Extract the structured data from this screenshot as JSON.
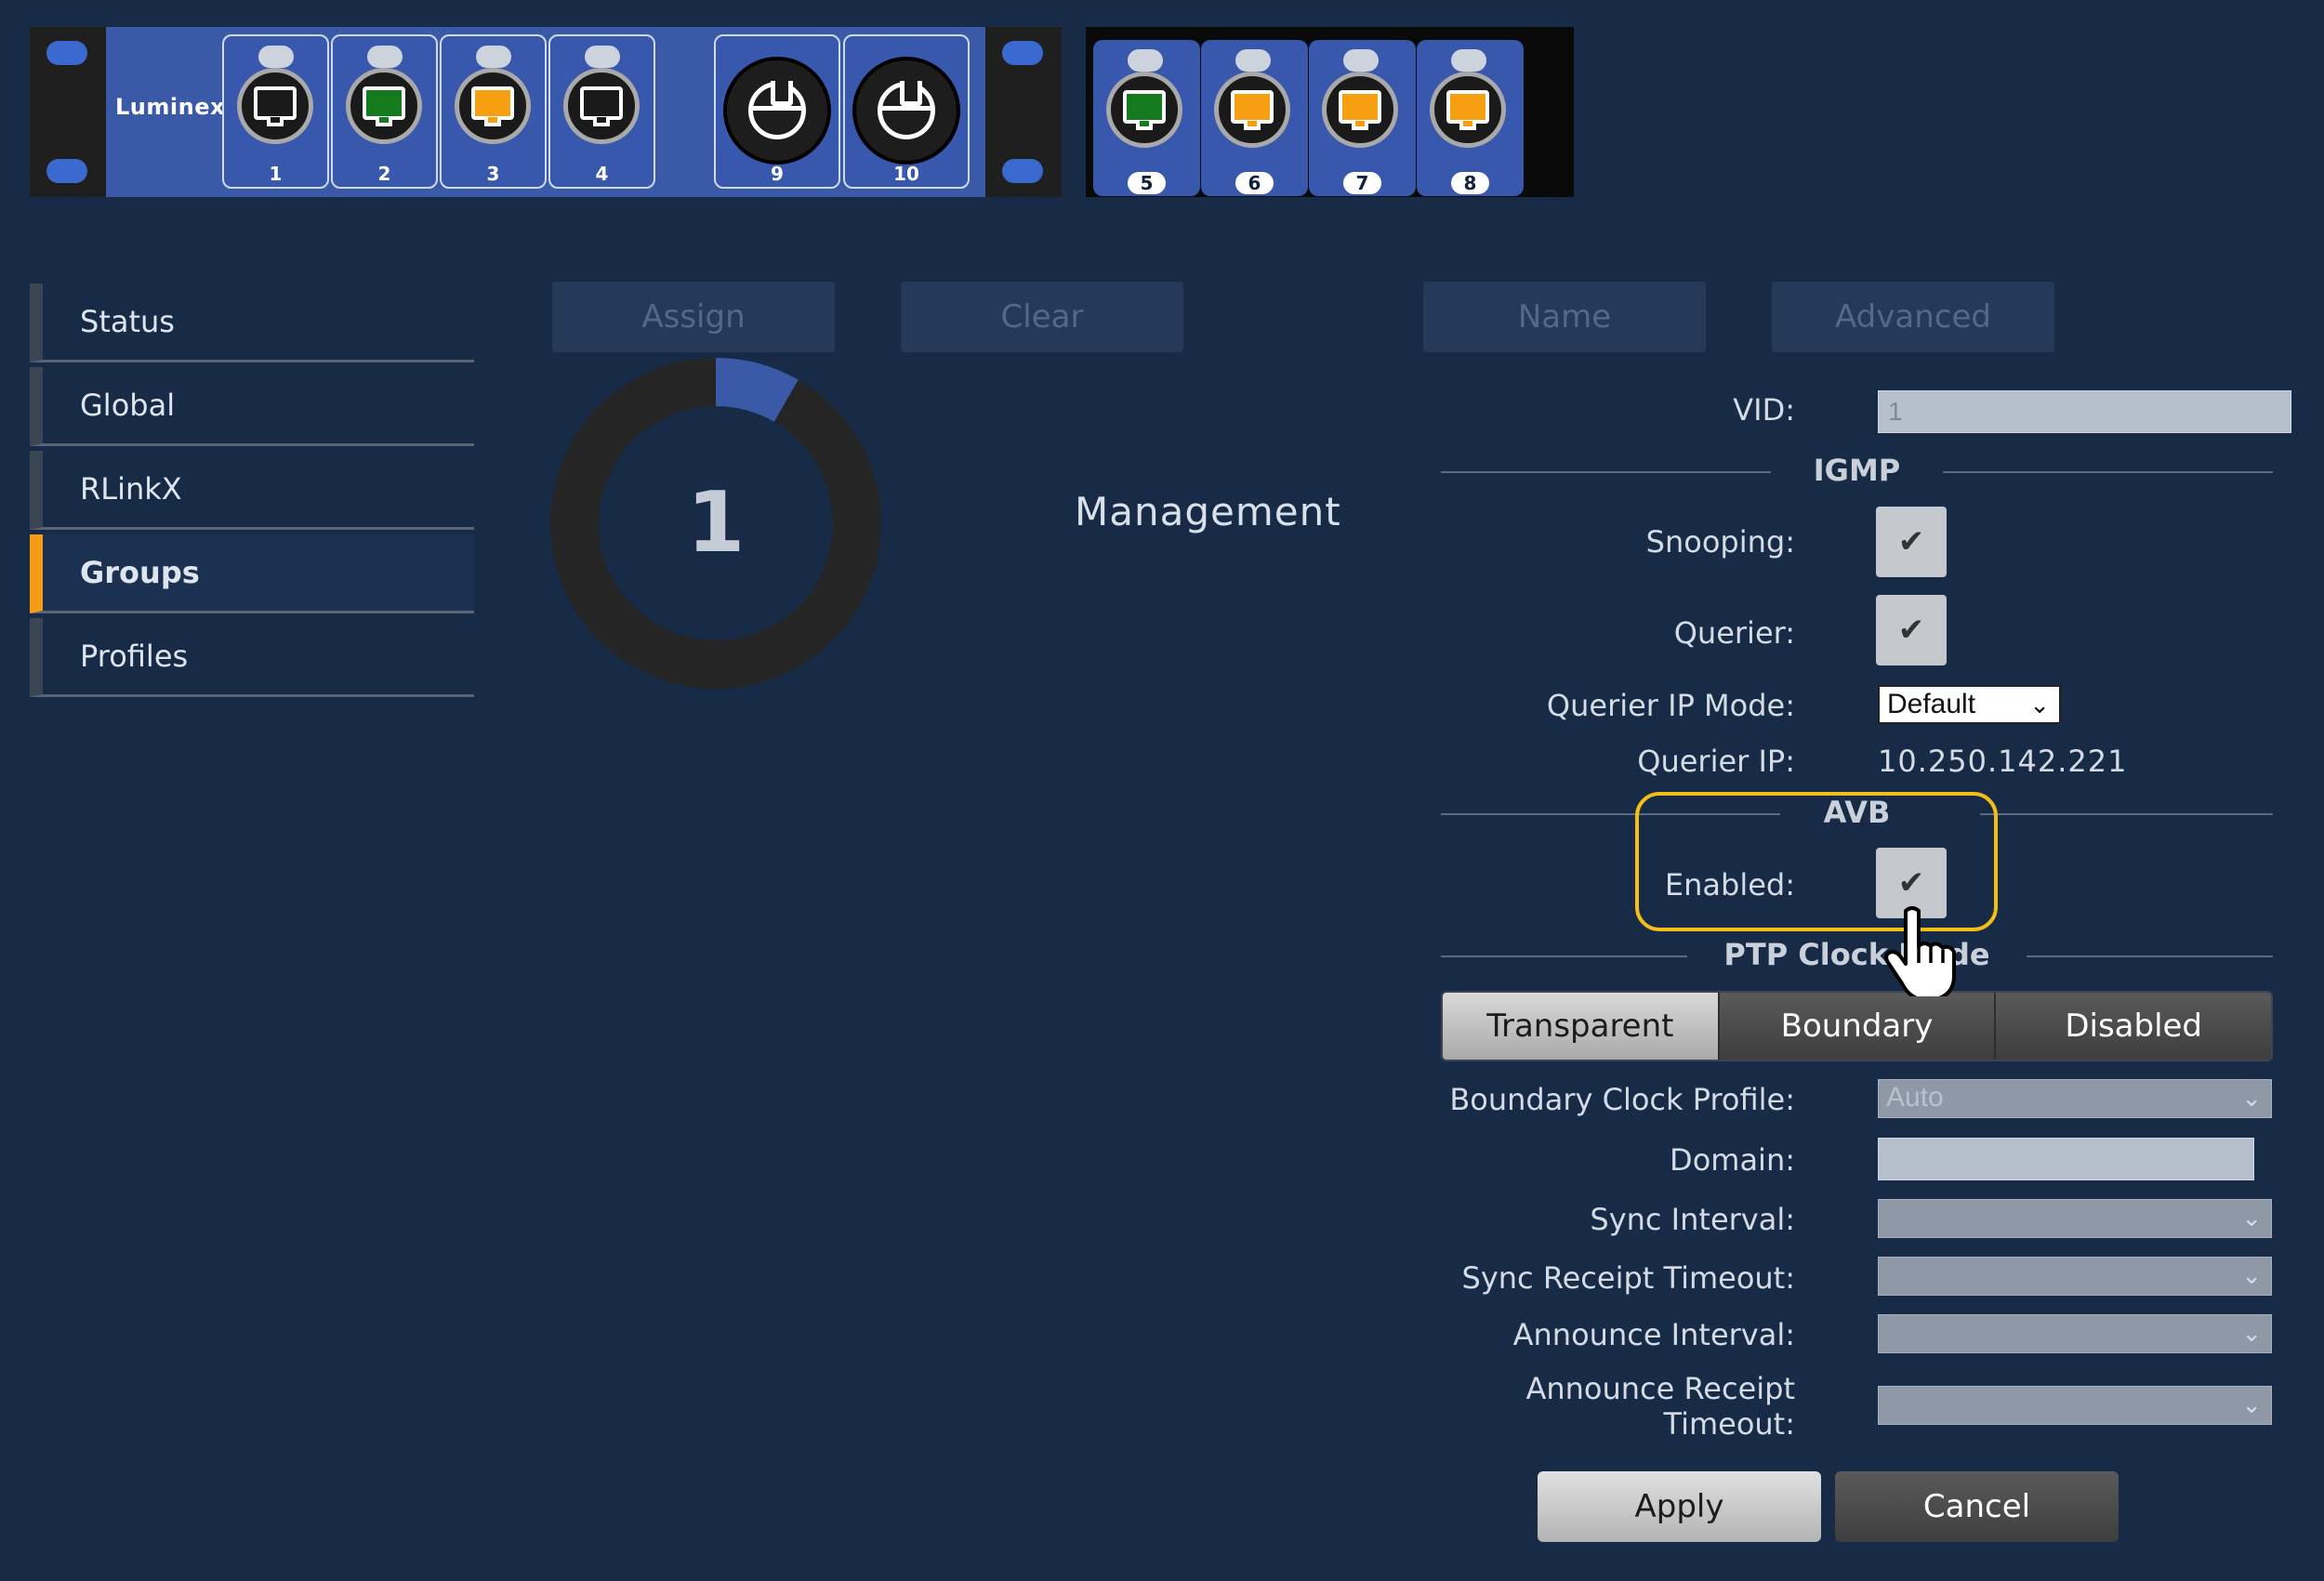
{
  "device": {
    "brand": "Luminex",
    "front_ports": [
      {
        "num": "1",
        "color": "#1a1a1a"
      },
      {
        "num": "2",
        "color": "#147a1e"
      },
      {
        "num": "3",
        "color": "#f6a011"
      },
      {
        "num": "4",
        "color": "#1a1a1a"
      }
    ],
    "xlr_ports": [
      "9",
      "10"
    ],
    "rear_ports": [
      {
        "num": "5",
        "color": "#147a1e"
      },
      {
        "num": "6",
        "color": "#f6a011"
      },
      {
        "num": "7",
        "color": "#f6a011"
      },
      {
        "num": "8",
        "color": "#f6a011"
      }
    ]
  },
  "sidebar": {
    "items": [
      {
        "label": "Status",
        "active": false
      },
      {
        "label": "Global",
        "active": false
      },
      {
        "label": "RLinkX",
        "active": false
      },
      {
        "label": "Groups",
        "active": true
      },
      {
        "label": "Profiles",
        "active": false
      }
    ]
  },
  "toolbar": {
    "assign": "Assign",
    "clear": "Clear",
    "name": "Name",
    "advanced": "Advanced"
  },
  "group": {
    "number": "1",
    "name": "Management",
    "donut_fraction": 0.083,
    "donut_color": "#3a5aa8"
  },
  "settings": {
    "vid_label": "VID:",
    "vid_value": "1",
    "igmp_title": "IGMP",
    "snooping_label": "Snooping:",
    "snooping_checked": true,
    "querier_label": "Querier:",
    "querier_checked": true,
    "querier_ip_mode_label": "Querier IP Mode:",
    "querier_ip_mode_value": "Default",
    "querier_ip_label": "Querier IP:",
    "querier_ip_value": "10.250.142.221",
    "avb_title": "AVB",
    "avb_enabled_label": "Enabled:",
    "avb_enabled_checked": true,
    "ptp_title": "PTP Clock Mode",
    "ptp_modes": [
      "Transparent",
      "Boundary",
      "Disabled"
    ],
    "ptp_selected": "Transparent",
    "boundary_clock_profile_label": "Boundary Clock Profile:",
    "boundary_clock_profile_value": "Auto",
    "domain_label": "Domain:",
    "sync_interval_label": "Sync Interval:",
    "sync_receipt_timeout_label": "Sync Receipt Timeout:",
    "announce_interval_label": "Announce Interval:",
    "announce_receipt_timeout_label_1": "Announce Receipt",
    "announce_receipt_timeout_label_2": "Timeout:"
  },
  "actions": {
    "apply": "Apply",
    "cancel": "Cancel"
  },
  "check_glyph": "✔",
  "chevron_glyph": "⌄"
}
